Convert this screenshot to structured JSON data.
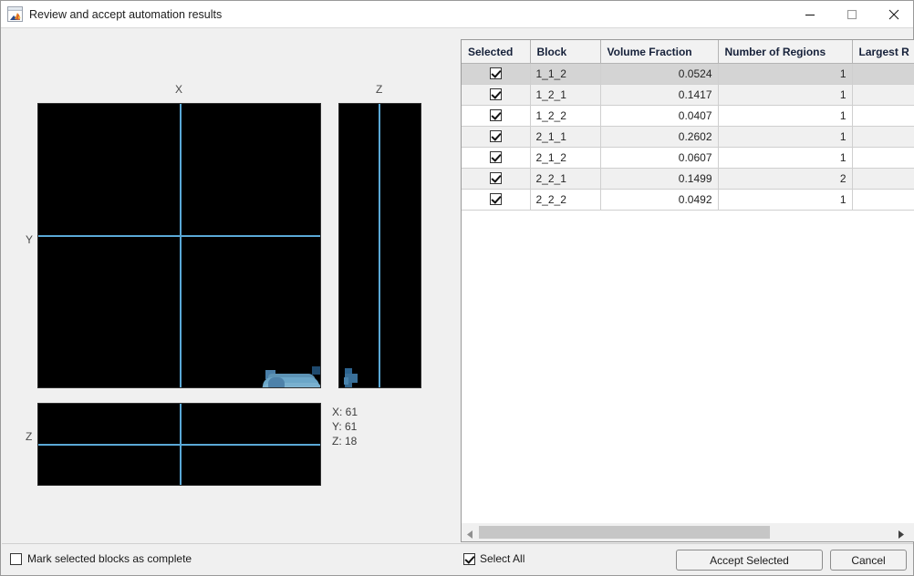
{
  "window": {
    "title": "Review and accept automation results",
    "icon": "matlab-icon",
    "controls": {
      "minimize": "minimize-icon",
      "maximize": "maximize-icon",
      "close": "close-icon"
    }
  },
  "viewer": {
    "labels": {
      "x": "X",
      "y": "Y",
      "z_top": "Z",
      "z_bottom": "Z"
    },
    "crosshair_color": "#5aa8d6",
    "blob_color": "#6ba6c8",
    "background_color": "#000000",
    "coordinates": {
      "x": "X: 61",
      "y": "Y: 61",
      "z": "Z: 18"
    }
  },
  "table": {
    "columns": [
      "Selected",
      "Block",
      "Volume Fraction",
      "Number of Regions",
      "Largest R"
    ],
    "rows": [
      {
        "selected": true,
        "block": "1_1_2",
        "volume_fraction": "0.0524",
        "number_of_regions": "1",
        "largest_r": "",
        "highlighted": true
      },
      {
        "selected": true,
        "block": "1_2_1",
        "volume_fraction": "0.1417",
        "number_of_regions": "1",
        "largest_r": "",
        "highlighted": false
      },
      {
        "selected": true,
        "block": "1_2_2",
        "volume_fraction": "0.0407",
        "number_of_regions": "1",
        "largest_r": "",
        "highlighted": false
      },
      {
        "selected": true,
        "block": "2_1_1",
        "volume_fraction": "0.2602",
        "number_of_regions": "1",
        "largest_r": "",
        "highlighted": false
      },
      {
        "selected": true,
        "block": "2_1_2",
        "volume_fraction": "0.0607",
        "number_of_regions": "1",
        "largest_r": "",
        "highlighted": false
      },
      {
        "selected": true,
        "block": "2_2_1",
        "volume_fraction": "0.1499",
        "number_of_regions": "2",
        "largest_r": "",
        "highlighted": false
      },
      {
        "selected": true,
        "block": "2_2_2",
        "volume_fraction": "0.0492",
        "number_of_regions": "1",
        "largest_r": "",
        "highlighted": false
      }
    ]
  },
  "scrollbar": {
    "left_arrow": "scroll-left-icon",
    "right_arrow": "scroll-right-icon"
  },
  "footer": {
    "mark_complete_label": "Mark selected blocks as complete",
    "mark_complete_checked": false,
    "select_all_label": "Select All",
    "select_all_checked": true,
    "accept_label": "Accept Selected",
    "cancel_label": "Cancel"
  }
}
